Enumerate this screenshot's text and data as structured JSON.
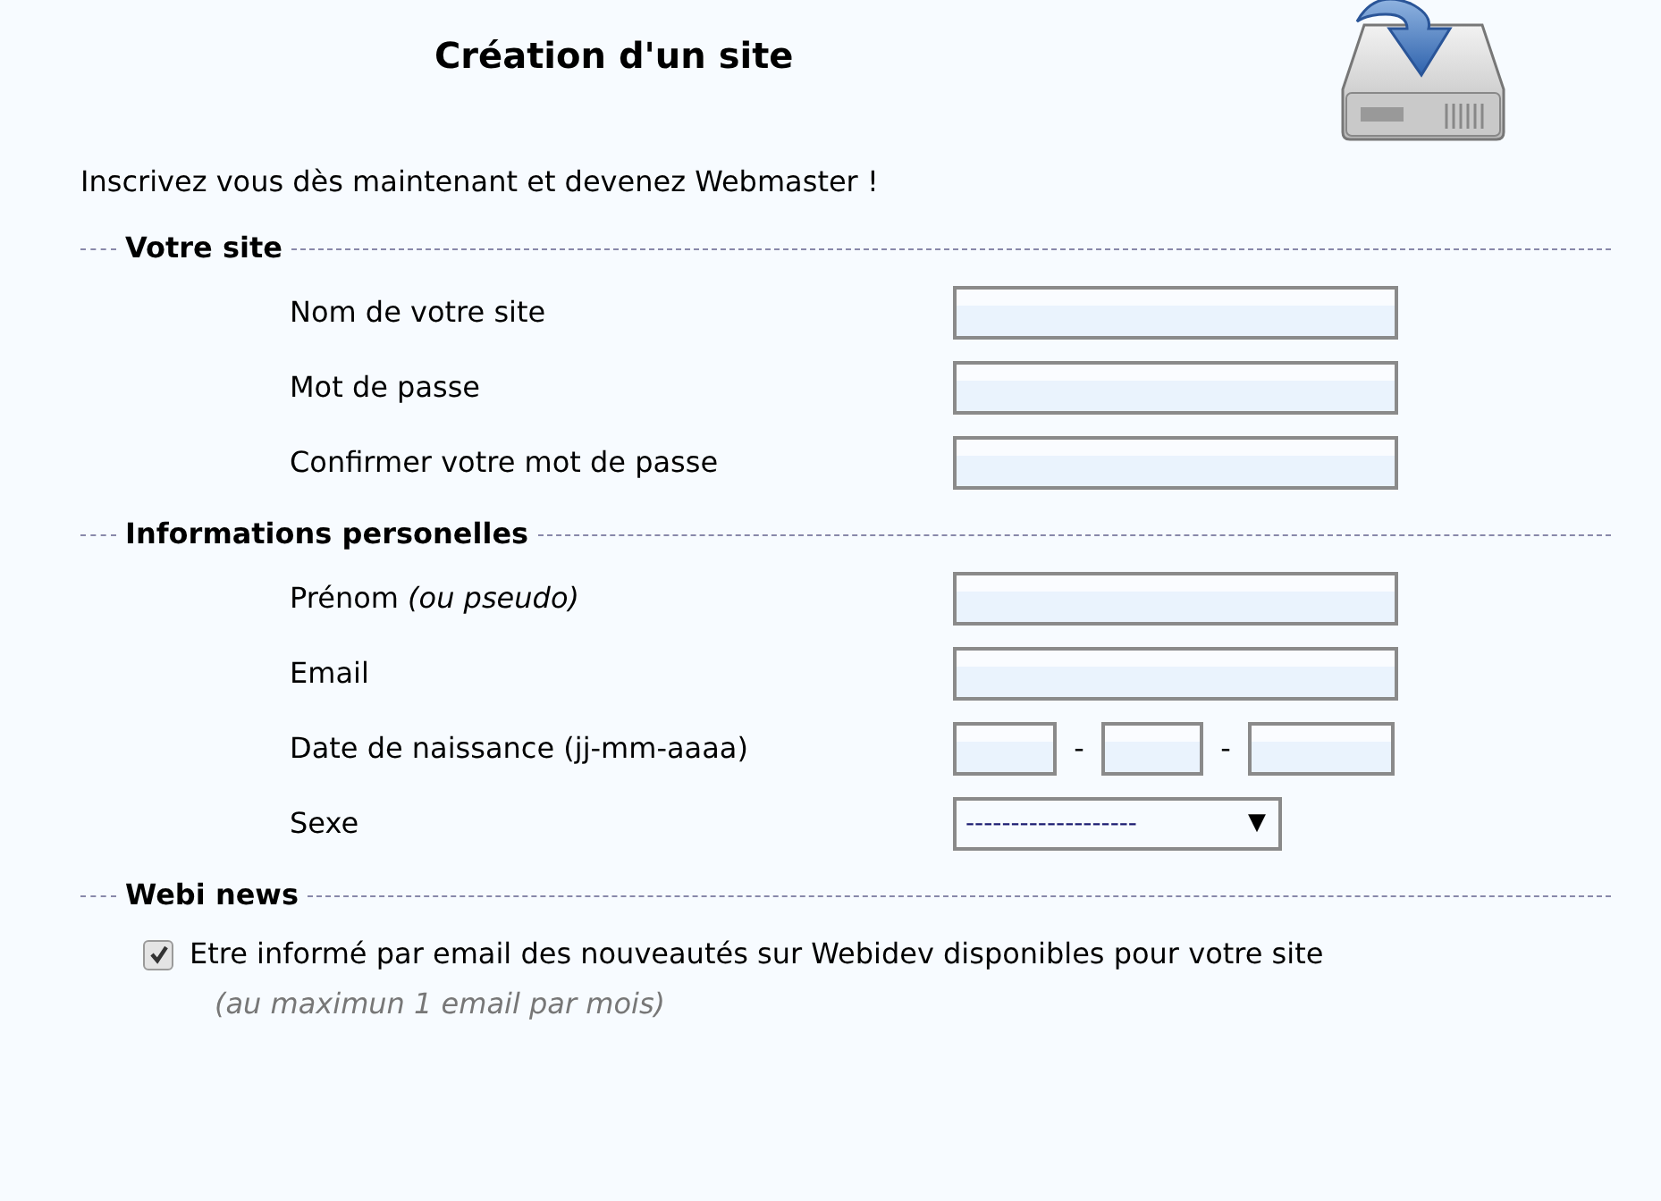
{
  "header": {
    "title": "Création d'un site"
  },
  "intro": "Inscrivez vous dès maintenant et devenez Webmaster !",
  "sections": [
    {
      "legend": "Votre site",
      "fields": [
        {
          "kind": "text",
          "label": "Nom de votre site"
        },
        {
          "kind": "text",
          "label": "Mot de passe"
        },
        {
          "kind": "text",
          "label": "Confirmer votre mot de passe"
        }
      ]
    },
    {
      "legend": "Informations personelles",
      "fields": [
        {
          "kind": "text",
          "label": "Prénom *(ou pseudo)*"
        },
        {
          "kind": "text",
          "label": "Email"
        },
        {
          "kind": "date",
          "label": "Date de naissance (jj-mm-aaaa)",
          "separators": [
            "-",
            "-"
          ]
        },
        {
          "kind": "select",
          "label": "Sexe",
          "value": "-------------------",
          "arrow": "▼"
        }
      ]
    },
    {
      "legend": "Webi news",
      "options": [
        {
          "label": "Etre informé par email des nouveautés sur Webidev disponibles pour votre site",
          "note": "(au maximun 1 email par mois)",
          "checked": true
        }
      ]
    }
  ]
}
